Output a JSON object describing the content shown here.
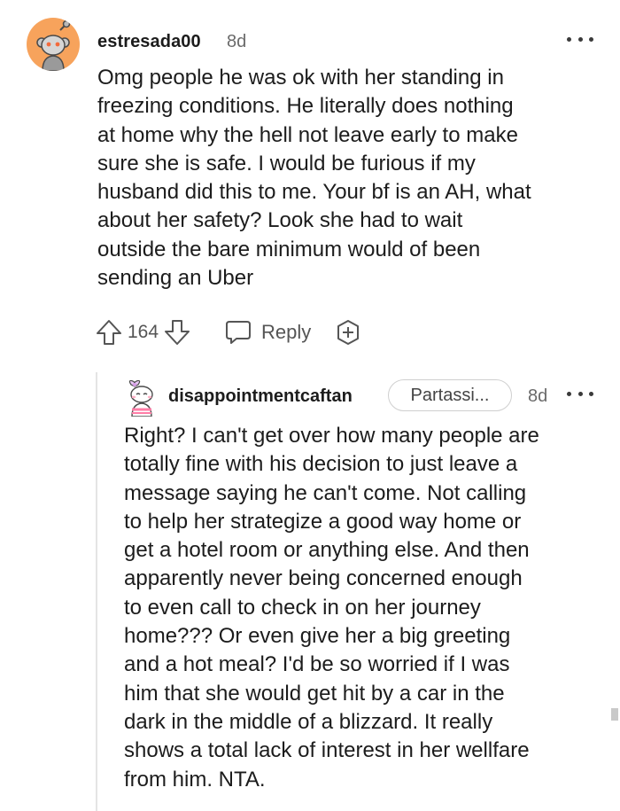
{
  "top_comment": {
    "username": "estresada00",
    "timestamp": "8d",
    "body": "Omg people he was ok with her standing in\nfreezing conditions. He literally does nothing\nat home why the hell not leave early to make\nsure she is safe. I would be furious if my\nhusband did this to me. Your bf is an AH, what\nabout her safety? Look she had to wait\noutside the bare minimum would of been\nsending an Uber",
    "vote_count": "164",
    "reply_label": "Reply",
    "avatar_icon": "snoo-avatar-icon",
    "avatar_color": "#f7a35c"
  },
  "reply_comment": {
    "username": "disappointmentcaftan",
    "flair": "Partassi...",
    "timestamp": "8d",
    "body": "Right? I can't get over how many people are\ntotally fine with his decision to just leave a\nmessage saying he can't come. Not calling\nto help her strategize a good way home or\nget a hotel room or anything else. And then\napparently never being concerned enough\nto even call to check in on her journey\nhome??? Or even give her a big greeting\nand a hot meal? I'd be so worried if I was\nhim that she would get hit by a car in the\ndark in the middle of a blizzard. It really\nshows a total lack of interest in her wellfare\nfrom him. NTA.",
    "avatar_icon": "snoo-avatar-icon"
  }
}
